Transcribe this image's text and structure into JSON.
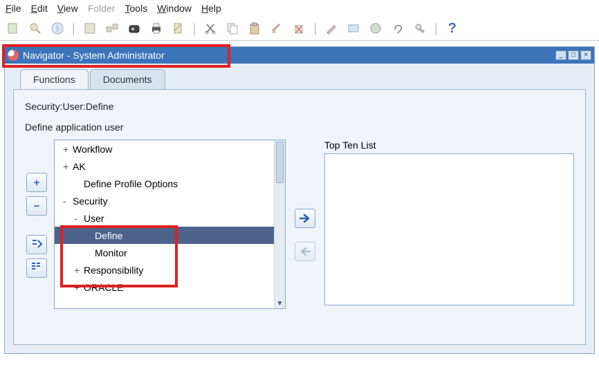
{
  "menu": {
    "file": "File",
    "edit": "Edit",
    "view": "View",
    "folder": "Folder",
    "tools": "Tools",
    "window": "Window",
    "help": "Help"
  },
  "window": {
    "title": "Navigator - System Administrator"
  },
  "tabs": {
    "functions": "Functions",
    "documents": "Documents"
  },
  "path": "Security:User:Define",
  "description": "Define application user",
  "tree": {
    "items": [
      {
        "exp": "+",
        "label": "Workflow",
        "indent": 1
      },
      {
        "exp": "+",
        "label": "AK",
        "indent": 1
      },
      {
        "exp": "",
        "label": "Define Profile Options",
        "indent": 2
      },
      {
        "exp": "-",
        "label": "Security",
        "indent": 1
      },
      {
        "exp": "-",
        "label": "User",
        "indent": 2
      },
      {
        "exp": "",
        "label": "Define",
        "indent": 3,
        "selected": true
      },
      {
        "exp": "",
        "label": "Monitor",
        "indent": 3
      },
      {
        "exp": "+",
        "label": "Responsibility",
        "indent": 2
      },
      {
        "exp": "+",
        "label": "ORACLE",
        "indent": 2
      }
    ]
  },
  "right": {
    "label": "Top Ten List"
  },
  "buttons": {
    "plus": "+",
    "minus": "−",
    "expand_down": "⤵",
    "expand_all": "⇲",
    "arrow_right": "➡",
    "arrow_left": "⬅"
  }
}
